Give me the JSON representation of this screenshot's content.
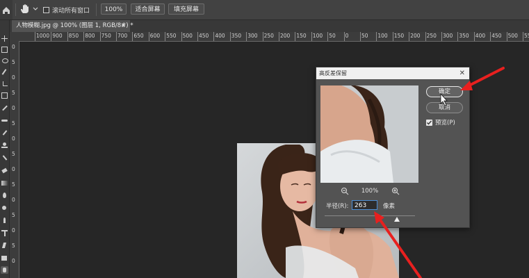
{
  "options_bar": {
    "home_icon": "home-icon",
    "tool_icon": "hand-icon",
    "scroll_all_label": "滚动所有窗口",
    "zoom_100_label": "100%",
    "fit_screen_label": "适合屏幕",
    "fill_screen_label": "填充屏幕"
  },
  "document": {
    "tab_title": "人物模糊.jpg @ 100% (图层 1, RGB/8#) *"
  },
  "rulers": {
    "top_labels": [
      "1000",
      "900",
      "850",
      "800",
      "750",
      "700",
      "650",
      "600",
      "550",
      "500",
      "450",
      "400",
      "350",
      "300",
      "250",
      "200",
      "150",
      "100",
      "50",
      "0",
      "50",
      "100",
      "150",
      "200",
      "250",
      "300",
      "350",
      "400",
      "450",
      "500",
      "550",
      "600",
      "650",
      "700",
      "750",
      "800",
      "850",
      "900",
      "950",
      "1000",
      "1050",
      "1100"
    ],
    "left_labels": [
      "0",
      "5",
      "0",
      "5",
      "0",
      "5",
      "0",
      "5",
      "0",
      "5",
      "0",
      "5",
      "0",
      "5",
      "0"
    ]
  },
  "dialog": {
    "title": "高反差保留",
    "ok_label": "确定",
    "cancel_label": "取消",
    "preview_label": "预览(P)",
    "preview_checked": true,
    "zoom_percent": "100%",
    "radius_label": "半径(R):",
    "radius_value": "263",
    "radius_unit": "像素",
    "slider_fraction": 0.8
  },
  "colors": {
    "annotation_arrow": "#e8201f",
    "app_background": "#262626",
    "dialog_background": "#535353"
  }
}
